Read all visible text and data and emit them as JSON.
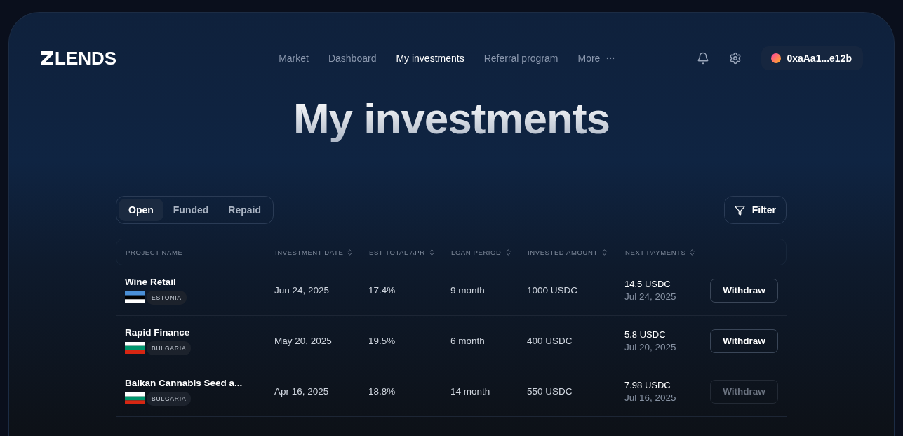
{
  "logo": "LENDS",
  "nav": [
    {
      "label": "Market",
      "selected": false
    },
    {
      "label": "Dashboard",
      "selected": false
    },
    {
      "label": "My investments",
      "selected": true
    },
    {
      "label": "Referral program",
      "selected": false
    },
    {
      "label": "More",
      "selected": false,
      "kind": "more"
    }
  ],
  "wallet": {
    "address": "0xaAa1...e12b"
  },
  "title": "My investments",
  "tabs": [
    {
      "label": "Open",
      "selected": true
    },
    {
      "label": "Funded",
      "selected": false
    },
    {
      "label": "Repaid",
      "selected": false
    }
  ],
  "filter_button": "Filter",
  "table": {
    "columns": [
      {
        "label": "PROJECT NAME",
        "sortable": false
      },
      {
        "label": "INVESTMENT DATE",
        "sortable": true
      },
      {
        "label": "EST TOTAL APR",
        "sortable": true
      },
      {
        "label": "LOAN PERIOD",
        "sortable": true
      },
      {
        "label": "INVESTED AMOUNT",
        "sortable": true
      },
      {
        "label": "NEXT PAYMENTS",
        "sortable": true
      }
    ],
    "rows": [
      {
        "project": "Wine Retail",
        "flag": {
          "kind": "estonia"
        },
        "country": "ESTONIA",
        "date": "Jun 24, 2025",
        "apr": "17.4%",
        "period": "9 month",
        "amount": "1000 USDC",
        "next_amount": "14.5 USDC",
        "next_date": "Jul 24, 2025",
        "action": "Withdraw",
        "disabled": false
      },
      {
        "project": "Rapid Finance",
        "flag": {
          "kind": "bulgaria"
        },
        "country": "BULGARIA",
        "date": "May 20, 2025",
        "apr": "19.5%",
        "period": "6 month",
        "amount": "400 USDC",
        "next_amount": "5.8 USDC",
        "next_date": "Jul 20, 2025",
        "action": "Withdraw",
        "disabled": false
      },
      {
        "project": "Balkan Cannabis Seed a...",
        "flag": {
          "kind": "bulgaria"
        },
        "country": "BULGARIA",
        "date": "Apr 16, 2025",
        "apr": "18.8%",
        "period": "14 month",
        "amount": "550 USDC",
        "next_amount": "7.98 USDC",
        "next_date": "Jul 16, 2025",
        "action": "Withdraw",
        "disabled": true
      }
    ]
  }
}
